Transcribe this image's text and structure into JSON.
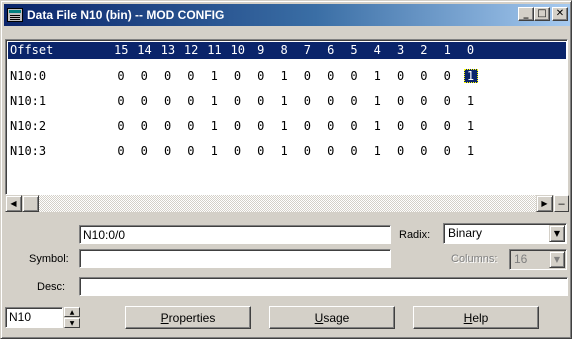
{
  "window": {
    "title": "Data File N10 (bin) -- MOD CONFIG",
    "minimize": "_",
    "maximize": "□",
    "close": "✕"
  },
  "grid": {
    "header": {
      "offset": "Offset",
      "bits": [
        "15",
        "14",
        "13",
        "12",
        "11",
        "10",
        "9",
        "8",
        "7",
        "6",
        "5",
        "4",
        "3",
        "2",
        "1",
        "0"
      ]
    },
    "rows": [
      {
        "offset": "N10:0",
        "bits": [
          "0",
          "0",
          "0",
          "0",
          "1",
          "0",
          "0",
          "1",
          "0",
          "0",
          "0",
          "1",
          "0",
          "0",
          "0",
          "1"
        ]
      },
      {
        "offset": "N10:1",
        "bits": [
          "0",
          "0",
          "0",
          "0",
          "1",
          "0",
          "0",
          "1",
          "0",
          "0",
          "0",
          "1",
          "0",
          "0",
          "0",
          "1"
        ]
      },
      {
        "offset": "N10:2",
        "bits": [
          "0",
          "0",
          "0",
          "0",
          "1",
          "0",
          "0",
          "1",
          "0",
          "0",
          "0",
          "1",
          "0",
          "0",
          "0",
          "1"
        ]
      },
      {
        "offset": "N10:3",
        "bits": [
          "0",
          "0",
          "0",
          "0",
          "1",
          "0",
          "0",
          "1",
          "0",
          "0",
          "0",
          "1",
          "0",
          "0",
          "0",
          "1"
        ]
      }
    ],
    "selected_cell": {
      "row": 0,
      "bit": "0"
    }
  },
  "scrollbar": {
    "left_arrow": "◀",
    "right_arrow": "▶",
    "split": "–"
  },
  "form": {
    "address_value": "N10:0/0",
    "radix_label": "Radix:",
    "radix_value": "Binary",
    "symbol_label": "Symbol:",
    "symbol_value": "",
    "columns_label": "Columns:",
    "columns_value": "16",
    "desc_label": "Desc:",
    "desc_value": "",
    "file_value": "N10",
    "combo_arrow": "▼",
    "spin_up": "▲",
    "spin_down": "▼"
  },
  "buttons": {
    "properties": {
      "accel": "P",
      "rest": "roperties"
    },
    "usage": {
      "accel": "U",
      "rest": "sage"
    },
    "help": {
      "accel": "H",
      "rest": "elp"
    }
  }
}
